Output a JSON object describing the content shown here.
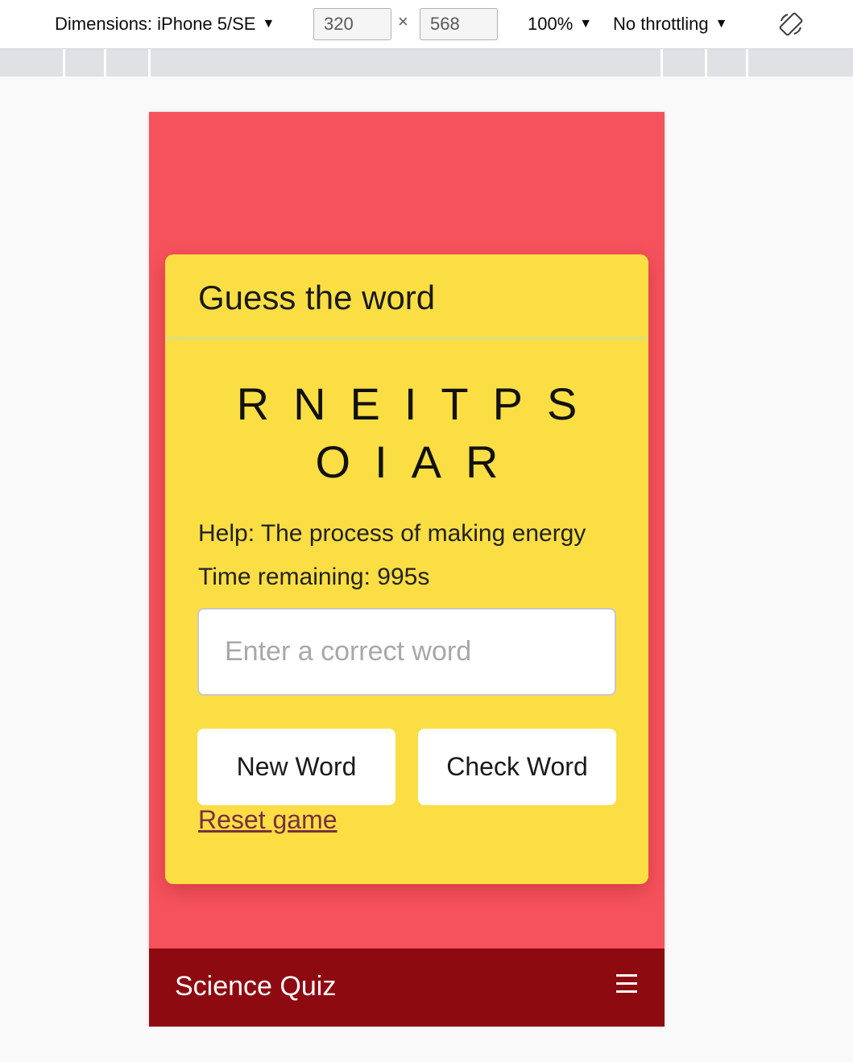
{
  "devtools": {
    "dimensions_label": "Dimensions: iPhone 5/SE",
    "width_value": "320",
    "times": "×",
    "height_value": "568",
    "zoom": "100%",
    "throttling": "No throttling",
    "icons": {
      "dropdown": "dropdown-arrow-icon",
      "rotate": "rotate-viewport-icon"
    }
  },
  "app": {
    "card_title": "Guess the word",
    "scrambled_line1": "RNEITPS",
    "scrambled_line2": "OIAR",
    "help_text": "Help: The process of making energy",
    "timer_text": "Time remaining: 995s",
    "input_placeholder": "Enter a correct word",
    "new_word_button": "New Word",
    "check_word_button": "Check Word",
    "reset_link": "Reset game",
    "footer_title": "Science Quiz",
    "menu_icon": "hamburger-menu-icon"
  },
  "colors": {
    "page_background": "#f5525c",
    "card_background": "#fbde44",
    "footer_background": "#8e0a11",
    "link_color": "#7a2f40"
  }
}
